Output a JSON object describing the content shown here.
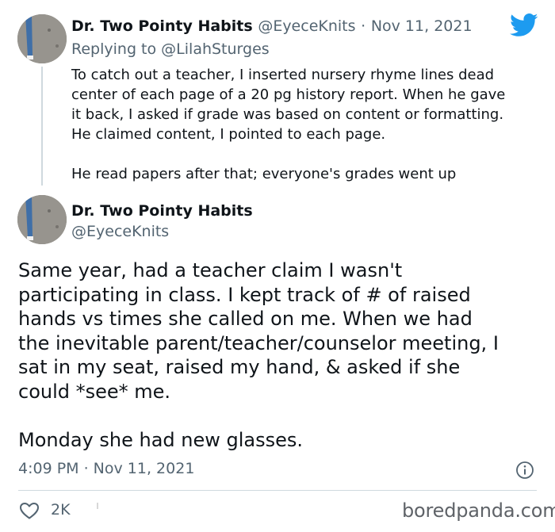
{
  "reply_tweet": {
    "author_name": "Dr. Two Pointy Habits",
    "author_handle": "@EyeceKnits",
    "date_separator": "·",
    "date": "Nov 11, 2021",
    "replying_prefix": "Replying to",
    "replying_to": "@LilahSturges",
    "lines": [
      "To catch out a teacher, I inserted nursery rhyme lines dead",
      "center of each page of a 20 pg history report. When he gave",
      "it back, I asked if grade was based on content or formatting.",
      "He claimed content, I pointed to each page."
    ],
    "closing_line": "He read papers after that; everyone's grades went up"
  },
  "main_tweet": {
    "author_name": "Dr. Two Pointy Habits",
    "author_handle": "@EyeceKnits",
    "lines": [
      "Same year, had a teacher claim I wasn't",
      "participating in class. I kept track of # of raised",
      "hands vs times she called on me. When we had",
      "the inevitable parent/teacher/counselor meeting, I",
      "sat in my seat, raised my hand, & asked if she",
      "could *see* me."
    ],
    "closing_line": "Monday she had new glasses.",
    "timestamp": "4:09 PM · Nov 11, 2021",
    "like_count": "2K"
  },
  "watermark": "boredpanda.com",
  "colors": {
    "text": "#0f1419",
    "secondary": "#536471",
    "twitter_blue": "#1d9bf0",
    "divider": "#cfd9de"
  },
  "icons": {
    "brand": "twitter-bird-icon",
    "info": "info-icon",
    "like": "heart-icon"
  }
}
